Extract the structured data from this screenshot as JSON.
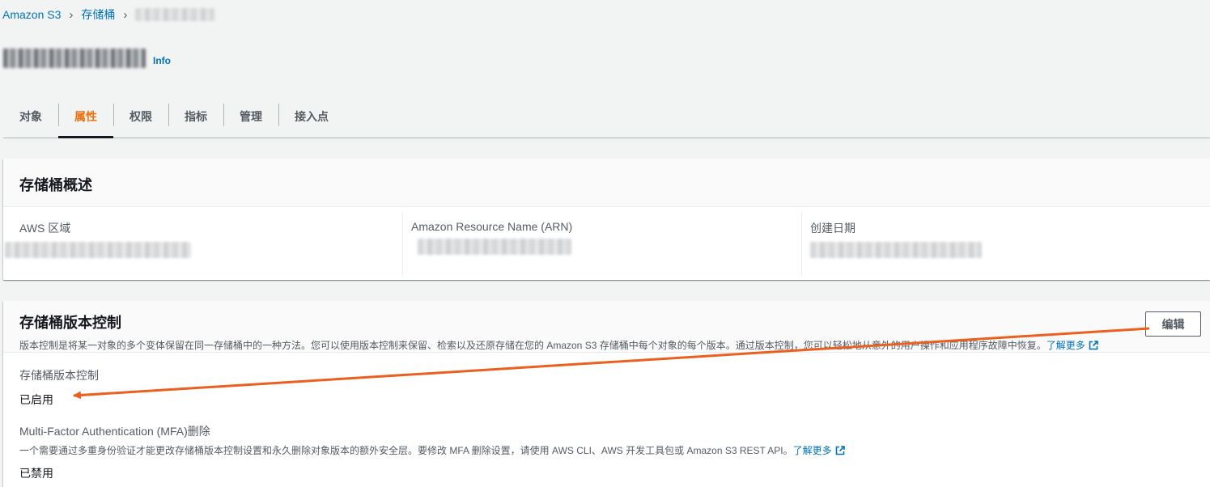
{
  "breadcrumb": {
    "items": [
      "Amazon S3",
      "存储桶"
    ]
  },
  "header": {
    "info_label": "Info"
  },
  "tabs": [
    {
      "label": "对象"
    },
    {
      "label": "属性",
      "active": true
    },
    {
      "label": "权限"
    },
    {
      "label": "指标"
    },
    {
      "label": "管理"
    },
    {
      "label": "接入点"
    }
  ],
  "overview": {
    "title": "存储桶概述",
    "fields": [
      {
        "label": "AWS 区域"
      },
      {
        "label": "Amazon Resource Name (ARN)"
      },
      {
        "label": "创建日期"
      }
    ]
  },
  "versioning": {
    "title": "存储桶版本控制",
    "description": "版本控制是将某一对象的多个变体保留在同一存储桶中的一种方法。您可以使用版本控制来保留、检索以及还原存储在您的 Amazon S3 存储桶中每个对象的每个版本。通过版本控制，您可以轻松地从意外的用户操作和应用程序故障中恢复。",
    "learn_more": "了解更多",
    "edit_label": "编辑",
    "status_label": "存储桶版本控制",
    "status_value": "已启用",
    "mfa_label": "Multi-Factor Authentication (MFA)删除",
    "mfa_description": "一个需要通过多重身份验证才能更改存储桶版本控制设置和永久删除对象版本的额外安全层。要修改 MFA 删除设置，请使用 AWS CLI、AWS 开发工具包或 Amazon S3 REST API。",
    "mfa_learn_more": "了解更多",
    "mfa_value": "已禁用"
  },
  "annotation": {
    "arrow_color": "#eb5f1f"
  }
}
